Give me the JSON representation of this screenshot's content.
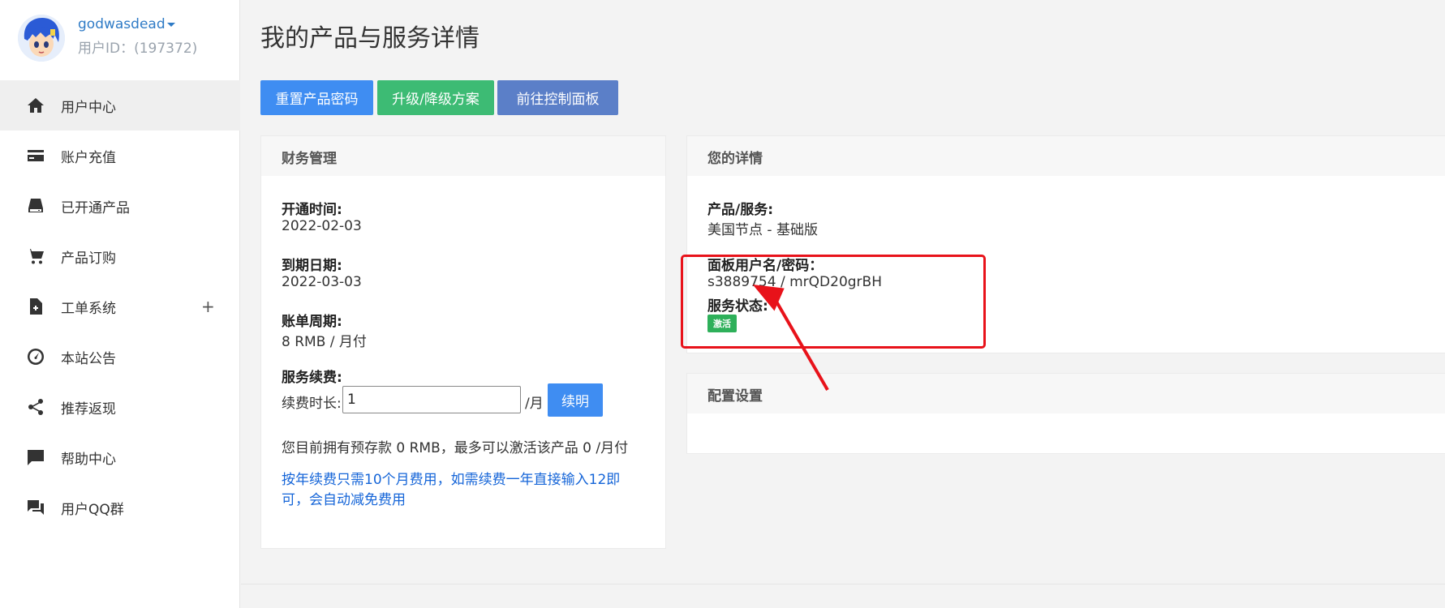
{
  "user": {
    "name": "godwasdead",
    "id_text": "用户ID：(197372)"
  },
  "sidebar": {
    "items": [
      {
        "label": "用户中心",
        "icon": "home-icon",
        "active": true
      },
      {
        "label": "账户充值",
        "icon": "credit-card-icon"
      },
      {
        "label": "已开通产品",
        "icon": "server-icon"
      },
      {
        "label": "产品订购",
        "icon": "cart-icon"
      },
      {
        "label": "工单系统",
        "icon": "ticket-icon",
        "expand": "+"
      },
      {
        "label": "本站公告",
        "icon": "dashboard-icon"
      },
      {
        "label": "推荐返现",
        "icon": "share-icon"
      },
      {
        "label": "帮助中心",
        "icon": "chat-icon"
      },
      {
        "label": "用户QQ群",
        "icon": "forum-icon"
      }
    ]
  },
  "page": {
    "title": "我的产品与服务详情"
  },
  "actions": {
    "reset_password": "重置产品密码",
    "upgrade": "升级/降级方案",
    "control_panel": "前往控制面板"
  },
  "finance": {
    "title": "财务管理",
    "open_time_label": "开通时间:",
    "open_time": "2022-02-03",
    "expire_label": "到期日期:",
    "expire": "2022-03-03",
    "billing_label": "账单周期:",
    "billing": "8 RMB / 月付",
    "renew_label": "服务续费:",
    "renew_duration_label": "续费时长:",
    "renew_duration_value": "1",
    "per_month": "/月",
    "renew_button": "续明",
    "balance_text": "您目前拥有预存款 0 RMB，最多可以激活该产品 0 /月付",
    "notice": "按年续费只需10个月费用，如需续费一年直接输入12即可，会自动减免费用"
  },
  "details": {
    "title": "您的详情",
    "product_label": "产品/服务:",
    "product": "美国节点 - 基础版",
    "panel_cred_label": "面板用户名/密码：",
    "panel_cred": "s3889754 / mrQD20grBH",
    "status_label": "服务状态:",
    "status": "激活"
  },
  "config": {
    "title": "配置设置"
  },
  "colors": {
    "accent_blue": "#3f8df2",
    "accent_green": "#3dbb74",
    "accent_steel": "#5b7fc8",
    "annotation_red": "#e8121a",
    "status_green": "#2eb05a"
  }
}
